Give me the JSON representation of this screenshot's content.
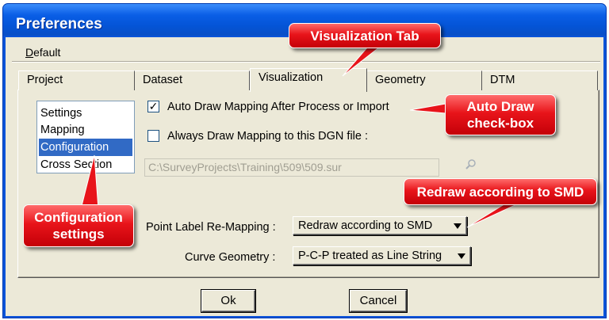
{
  "window": {
    "title": "Preferences"
  },
  "menu": {
    "default_label": "Default"
  },
  "tabs": [
    {
      "label": "Project"
    },
    {
      "label": "Dataset"
    },
    {
      "label": "Visualization"
    },
    {
      "label": "Geometry"
    },
    {
      "label": "DTM"
    }
  ],
  "active_tab": "Visualization",
  "list": {
    "items": [
      "Settings",
      "Mapping",
      "Configuration",
      "Cross Section"
    ],
    "selected": "Configuration"
  },
  "options": {
    "auto_draw": {
      "label": "Auto Draw Mapping After Process or Import",
      "checked": true,
      "mark": "✓"
    },
    "always_draw": {
      "label": "Always Draw Mapping to this DGN file :",
      "checked": false
    },
    "dgn_path": "C:\\SurveyProjects\\Training\\509\\509.sur"
  },
  "point_label": {
    "label": "Point Label Re-Mapping :",
    "value": "Redraw according to SMD"
  },
  "curve_geometry": {
    "label": "Curve Geometry  :",
    "value": "P-C-P treated as Line String"
  },
  "buttons": {
    "ok": "Ok",
    "cancel": "Cancel"
  },
  "callouts": {
    "visualization_tab": "Visualization Tab",
    "auto_draw_line1": "Auto Draw",
    "auto_draw_line2": "check-box",
    "redraw_smd": "Redraw according to SMD",
    "configuration_line1": "Configuration",
    "configuration_line2": "settings"
  },
  "colors": {
    "titlebar": "#0a5ee6",
    "dialog_bg": "#ece9d8",
    "selection": "#316ac5",
    "callout": "#e8141a"
  },
  "icons": {
    "browse": "magnifier-icon",
    "dropdown": "triangle-down-icon"
  }
}
